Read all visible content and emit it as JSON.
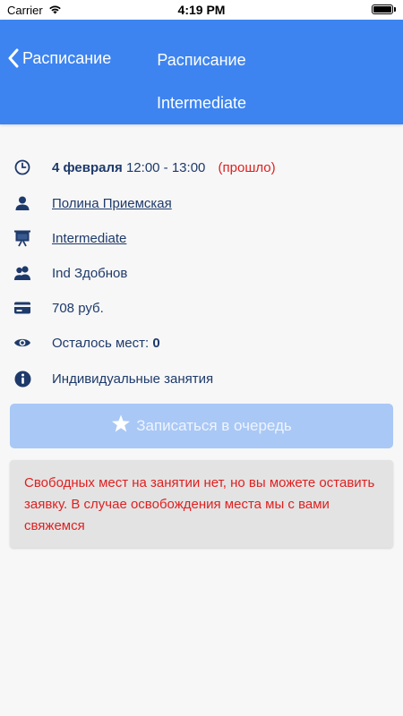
{
  "status_bar": {
    "carrier": "Carrier",
    "time": "4:19 PM"
  },
  "header": {
    "back_label": "Расписание",
    "title": "Расписание",
    "subtitle": "Intermediate"
  },
  "lesson": {
    "date": "4 февраля",
    "time": "12:00 - 13:00",
    "status": "(прошло)",
    "teacher": "Полина Приемская",
    "level": "Intermediate",
    "group": "Ind Здобнов",
    "price": "708 руб.",
    "seats_label": "Осталось мест:",
    "seats_value": "0",
    "type": "Индивидуальные занятия"
  },
  "queue_button": {
    "label": "Записаться в очередь"
  },
  "notice": {
    "text": "Свободных мест на занятии нет, но вы можете оставить заявку. В случае освобождения места мы с вами свяжемся"
  },
  "colors": {
    "header_bg": "#3d84f0",
    "text_dark_blue": "#1e3a6b",
    "link_blue": "#3d84f0",
    "alert_red": "#e02020",
    "disabled_button": "#a9c8f5"
  }
}
